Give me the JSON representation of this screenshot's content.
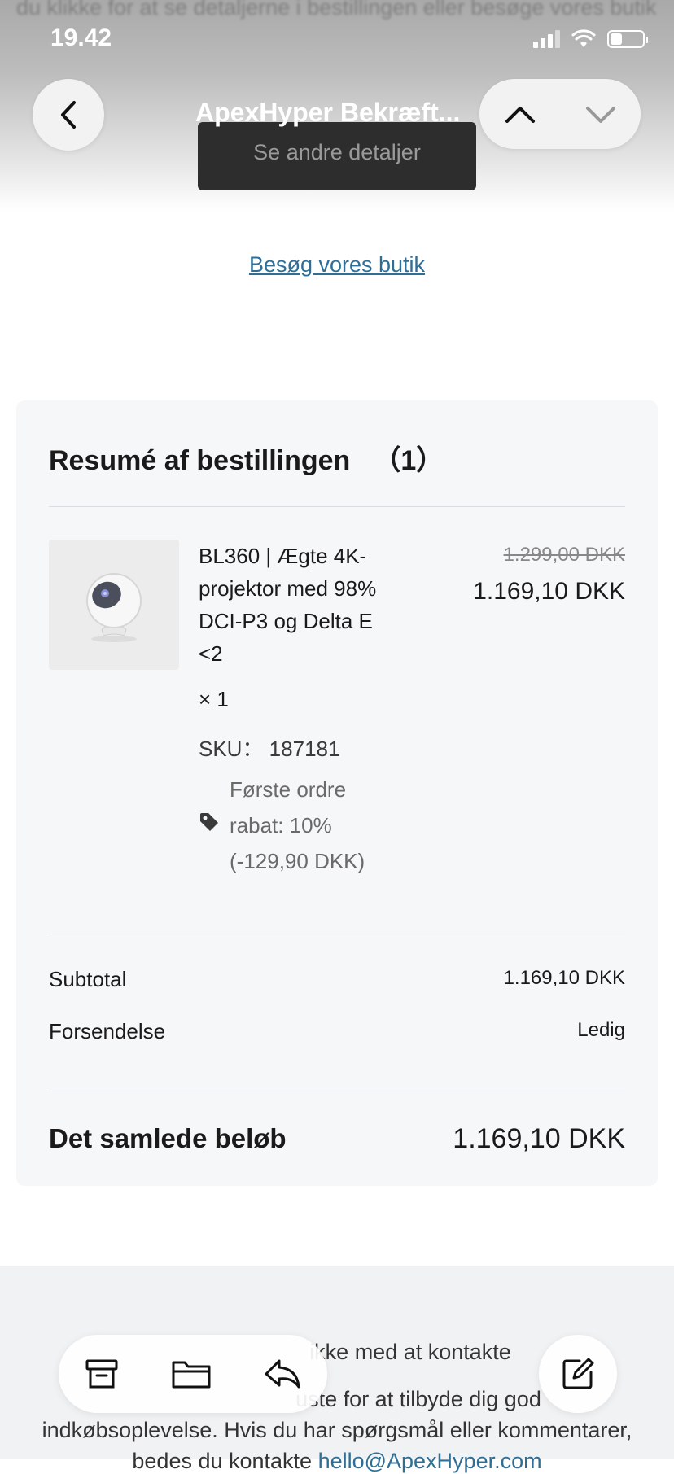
{
  "status_bar": {
    "time": "19.42"
  },
  "header": {
    "ghost_text": "du klikke for at se detaljerne i bestillingen eller besøge vores butik",
    "title": "ApexHyper Bekræft...",
    "tooltip": "Se andre detaljer"
  },
  "body": {
    "visit_store_link": "Besøg vores butik"
  },
  "summary": {
    "title": "Resumé af bestillingen",
    "count": "（1）",
    "item": {
      "name": "BL360 | Ægte 4K-projektor med 98% DCI-P3 og Delta E <2",
      "quantity": "× 1",
      "sku": "SKU： 187181",
      "discount": "Første ordre rabat: 10% (-129,90 DKK)",
      "price_original": "1.299,00 DKK",
      "price_current": "1.169,10 DKK"
    },
    "subtotal_label": "Subtotal",
    "subtotal_value": "1.169,10 DKK",
    "shipping_label": "Forsendelse",
    "shipping_value": "Ledig",
    "total_label": "Det samlede beløb",
    "total_value": "1.169,10 DKK"
  },
  "footer": {
    "line1": "ikke med at kontakte",
    "line2": "uste for at tilbyde dig god",
    "line3": "indkøbsoplevelse. Hvis du har spørgsmål eller kommentarer,",
    "line4_prefix": "bedes du kontakte ",
    "email": "hello@ApexHyper.com"
  },
  "icons": {
    "back": "chevron-left-icon",
    "up": "chevron-up-icon",
    "down": "chevron-down-icon",
    "archive": "archive-icon",
    "folder": "folder-icon",
    "reply": "reply-icon",
    "compose": "compose-icon",
    "tag": "tag-icon"
  }
}
